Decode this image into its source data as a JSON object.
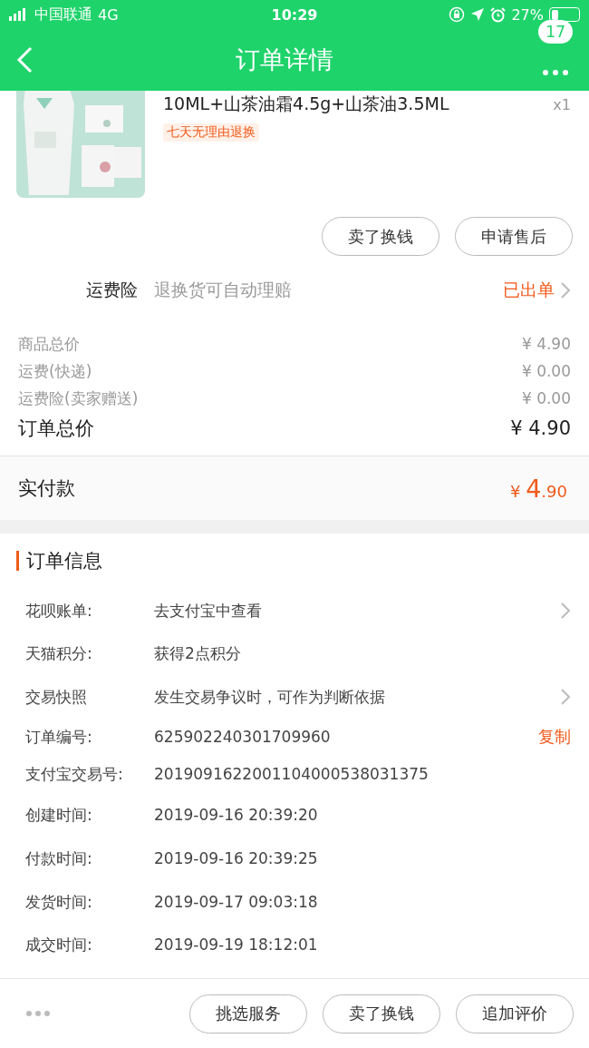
{
  "status_bar": {
    "carrier": "中国联通",
    "network": "4G",
    "time": "10:29",
    "battery": "27%"
  },
  "nav": {
    "title": "订单详情",
    "badge": "17"
  },
  "product": {
    "kind": "picture",
    "title": "10ML+山茶油霜4.5g+山茶油3.5ML",
    "quantity": "x1",
    "tag": "七天无理由退换"
  },
  "product_buttons": [
    "卖了换钱",
    "申请售后"
  ],
  "insurance": {
    "label": "运费险",
    "description": "退换货可自动理赔",
    "status": "已出单"
  },
  "price_rows": [
    {
      "label": "商品总价",
      "value": "¥ 4.90",
      "kind": "minor"
    },
    {
      "label": "运费(快递)",
      "value": "¥ 0.00",
      "kind": "minor"
    },
    {
      "label": "运费险(卖家赠送)",
      "value": "¥ 0.00",
      "kind": "minor"
    },
    {
      "label": "订单总价",
      "value": "¥ 4.90",
      "kind": "total"
    }
  ],
  "paid": {
    "label": "实付款",
    "currency": "¥",
    "integer": "4",
    "decimal": ".90"
  },
  "order_info": {
    "title": "订单信息",
    "rows": [
      {
        "label": "花呗账单:",
        "value": "去支付宝中查看",
        "kind": "link"
      },
      {
        "label": "天猫积分:",
        "value": "获得2点积分",
        "kind": "plain"
      },
      {
        "label": "交易快照",
        "value": "发生交易争议时，可作为判断依据",
        "kind": "link"
      },
      {
        "label": "订单编号:",
        "value": "625902240301709960",
        "kind": "copyable",
        "action_text": "复制"
      },
      {
        "label": "支付宝交易号:",
        "value": "2019091622001104000538031375",
        "kind": "plain"
      },
      {
        "label": "创建时间:",
        "value": "2019-09-16 20:39:20",
        "kind": "plain"
      },
      {
        "label": "付款时间:",
        "value": "2019-09-16 20:39:25",
        "kind": "plain"
      },
      {
        "label": "发货时间:",
        "value": "2019-09-17 09:03:18",
        "kind": "plain"
      },
      {
        "label": "成交时间:",
        "value": "2019-09-19 18:12:01",
        "kind": "plain"
      }
    ]
  },
  "bottom_buttons": [
    "挑选服务",
    "卖了换钱",
    "追加评价"
  ]
}
